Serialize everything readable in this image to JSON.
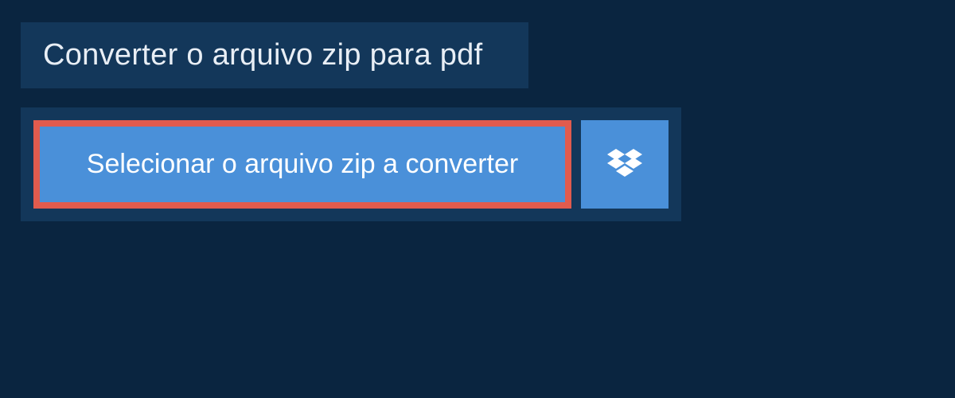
{
  "header": {
    "title": "Converter o arquivo zip para pdf"
  },
  "actions": {
    "select_file_label": "Selecionar o arquivo zip a converter"
  },
  "colors": {
    "background": "#0a2540",
    "panel": "#13375a",
    "button": "#4a90d9",
    "highlight_border": "#e15b4e",
    "text_light": "#e8eef5",
    "text_white": "#ffffff"
  }
}
